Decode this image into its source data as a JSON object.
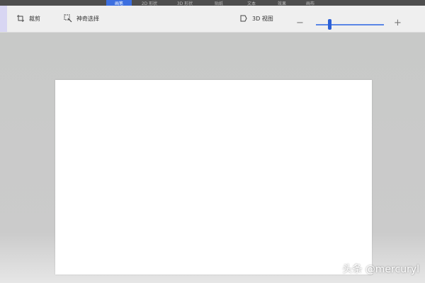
{
  "tabs": [
    {
      "label": "画笔",
      "active": true
    },
    {
      "label": "2D 形状",
      "active": false
    },
    {
      "label": "3D 形状",
      "active": false
    },
    {
      "label": "贴纸",
      "active": false
    },
    {
      "label": "文本",
      "active": false
    },
    {
      "label": "效果",
      "active": false
    },
    {
      "label": "画布",
      "active": false
    }
  ],
  "toolbar": {
    "crop_label": "裁剪",
    "magic_select_label": "神奇选择",
    "view3d_label": "3D 视图",
    "zoom_minus": "−",
    "zoom_plus": "+",
    "zoom_level": 0.2
  },
  "watermark": "头条 @mercuryl",
  "colors": {
    "accent": "#3d6fe0",
    "toolbar_bg": "#efefef",
    "workspace_bg": "#c9c9c9",
    "canvas_bg": "#ffffff"
  },
  "icons": {
    "crop": "crop-icon",
    "magic_select": "magic-select-icon",
    "view3d": "view-3d-icon"
  }
}
